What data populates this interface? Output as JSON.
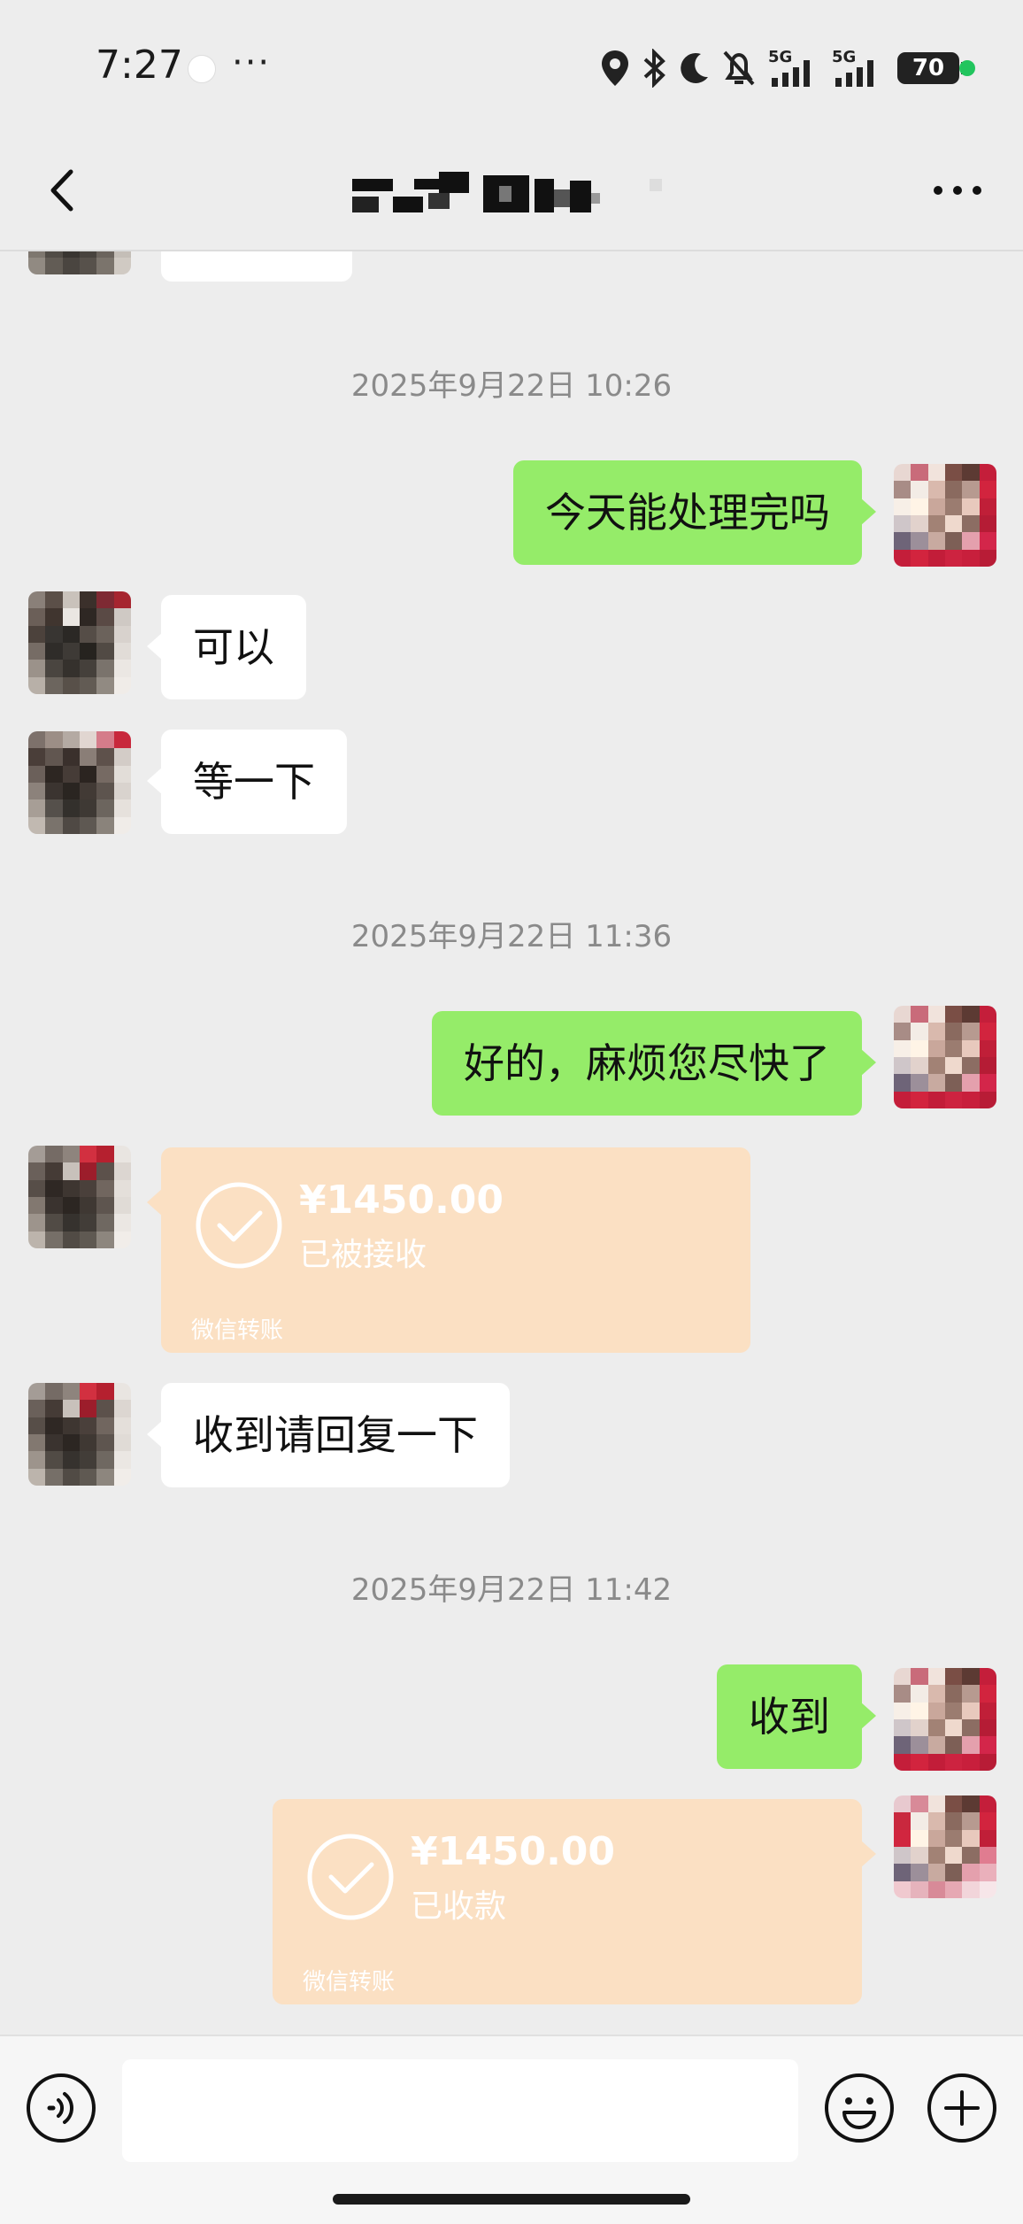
{
  "status_bar": {
    "time": "7:27",
    "more": "···",
    "network_1": "5G",
    "network_2": "5G",
    "battery": "70"
  },
  "header": {
    "back_icon": "chevron-left-icon",
    "more_icon": "more-horizontal-icon"
  },
  "colors": {
    "background": "#ededed",
    "sent_bubble": "#95ec69",
    "received_bubble": "#ffffff",
    "transfer_card": "#fbe0c3"
  },
  "messages": {
    "ts1": "2025年9月22日 10:26",
    "m1": "今天能处理完吗",
    "m2": "可以",
    "m3": "等一下",
    "ts2": "2025年9月22日 11:36",
    "m4": "好的，麻烦您尽快了",
    "transfer1": {
      "amount": "¥1450.00",
      "status": "已被接收",
      "footer": "微信转账"
    },
    "m5": "收到请回复一下",
    "ts3": "2025年9月22日 11:42",
    "m6": "收到",
    "transfer2": {
      "amount": "¥1450.00",
      "status": "已收款",
      "footer": "微信转账"
    }
  },
  "input_bar": {
    "text_value": "",
    "voice_icon": "voice-icon",
    "emoji_icon": "emoji-icon",
    "plus_icon": "plus-icon"
  }
}
